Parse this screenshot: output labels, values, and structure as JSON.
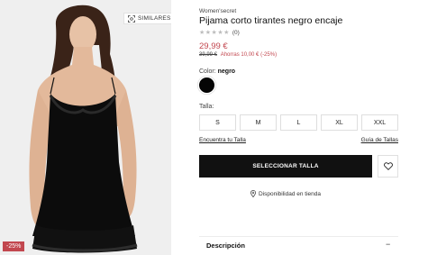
{
  "image": {
    "similar_label": "SIMILARES",
    "discount_badge": "-25%"
  },
  "product": {
    "brand": "Women'secret",
    "title": "Pijama corto tirantes negro encaje",
    "stars": "★★★★★",
    "rating_count": "(0)",
    "price": "29,99 €",
    "old_price": "39,99 €",
    "savings": "Ahorras 10,00 € (-25%)"
  },
  "color": {
    "label": "Color:",
    "value": "negro",
    "swatch_hex": "#050505"
  },
  "size": {
    "label": "Talla:",
    "options": [
      "S",
      "M",
      "L",
      "XL",
      "XXL"
    ]
  },
  "links": {
    "find_size": "Encuentra tu Talla",
    "size_guide": "Guía de Tallas"
  },
  "actions": {
    "select_size": "SELECCIONAR TALLA",
    "wishlist_icon": "heart-icon"
  },
  "availability": {
    "label": "Disponibilidad en tienda",
    "icon": "location-pin-icon"
  },
  "description": {
    "title": "Descripción",
    "toggle": "−"
  }
}
